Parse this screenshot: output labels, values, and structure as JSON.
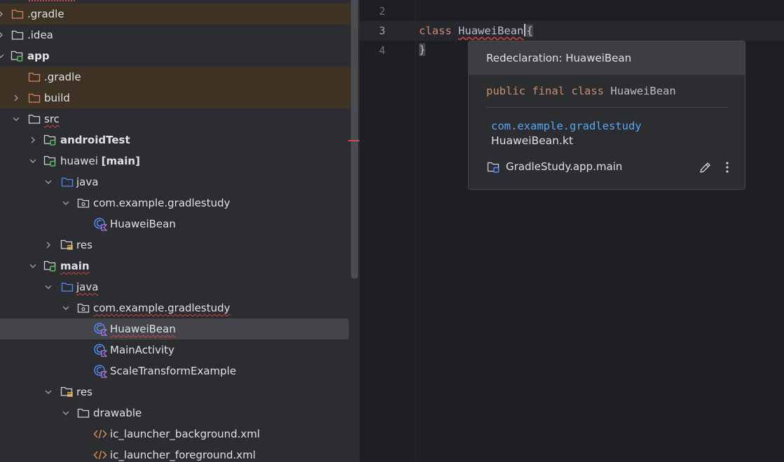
{
  "tree": {
    "rows": [
      {
        "label": ".gradle",
        "bold": false
      },
      {
        "label": ".idea",
        "bold": false
      },
      {
        "label": "app",
        "bold": true
      },
      {
        "label": ".gradle",
        "bold": false
      },
      {
        "label": "build",
        "bold": false
      },
      {
        "label": "src",
        "bold": false
      },
      {
        "label": "androidTest",
        "bold": true
      },
      {
        "label": "huawei",
        "suffix": "[main]"
      },
      {
        "label": "java"
      },
      {
        "label": "com.example.gradlestudy"
      },
      {
        "label": "HuaweiBean"
      },
      {
        "label": "res"
      },
      {
        "label": "main",
        "bold": true
      },
      {
        "label": "java"
      },
      {
        "label": "com.example.gradlestudy"
      },
      {
        "label": "HuaweiBean"
      },
      {
        "label": "MainActivity"
      },
      {
        "label": "ScaleTransformExample"
      },
      {
        "label": "res"
      },
      {
        "label": "drawable"
      },
      {
        "label": "ic_launcher_background.xml"
      },
      {
        "label": "ic_launcher_foreground.xml"
      }
    ]
  },
  "editor": {
    "line_numbers": [
      "2",
      "3",
      "4"
    ],
    "code": {
      "kw_class": "class",
      "class_name": "HuaweiBean",
      "open_brace": "{",
      "close_brace": "}"
    }
  },
  "popup": {
    "title": "Redeclaration: HuaweiBean",
    "sig_public": "public",
    "sig_final": "final",
    "sig_class": "class",
    "sig_name": "HuaweiBean",
    "package": "com.example.gradlestudy",
    "file": "HuaweiBean.kt",
    "module": "GradleStudy.app.main"
  },
  "colors": {
    "excluded_bg": "#3d3223",
    "keyword": "#cf8e6d",
    "package_link": "#56a8f5",
    "error_underline": "#d0463e"
  }
}
